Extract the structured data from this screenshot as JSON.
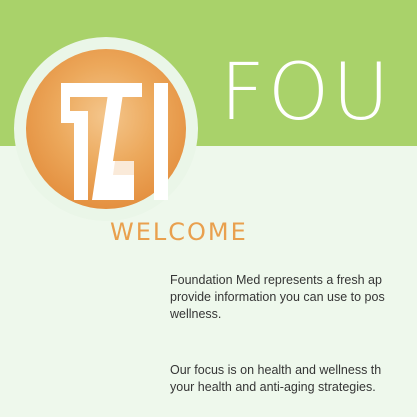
{
  "header": {
    "brand_title": "FOU"
  },
  "main": {
    "welcome_heading": "WELCOME",
    "paragraphs": [
      "Foundation Med represents a fresh ap\nprovide information you can use to pos\nwellness.",
      "Our focus is on health and wellness th\nyour health and anti-aging strategies."
    ]
  },
  "colors": {
    "header_green": "#a9d26a",
    "page_background": "#eef8ec",
    "logo_orange": "#e9a04e",
    "text_dark": "#353535"
  },
  "icons": {
    "logo": "foundation-med-logo"
  }
}
